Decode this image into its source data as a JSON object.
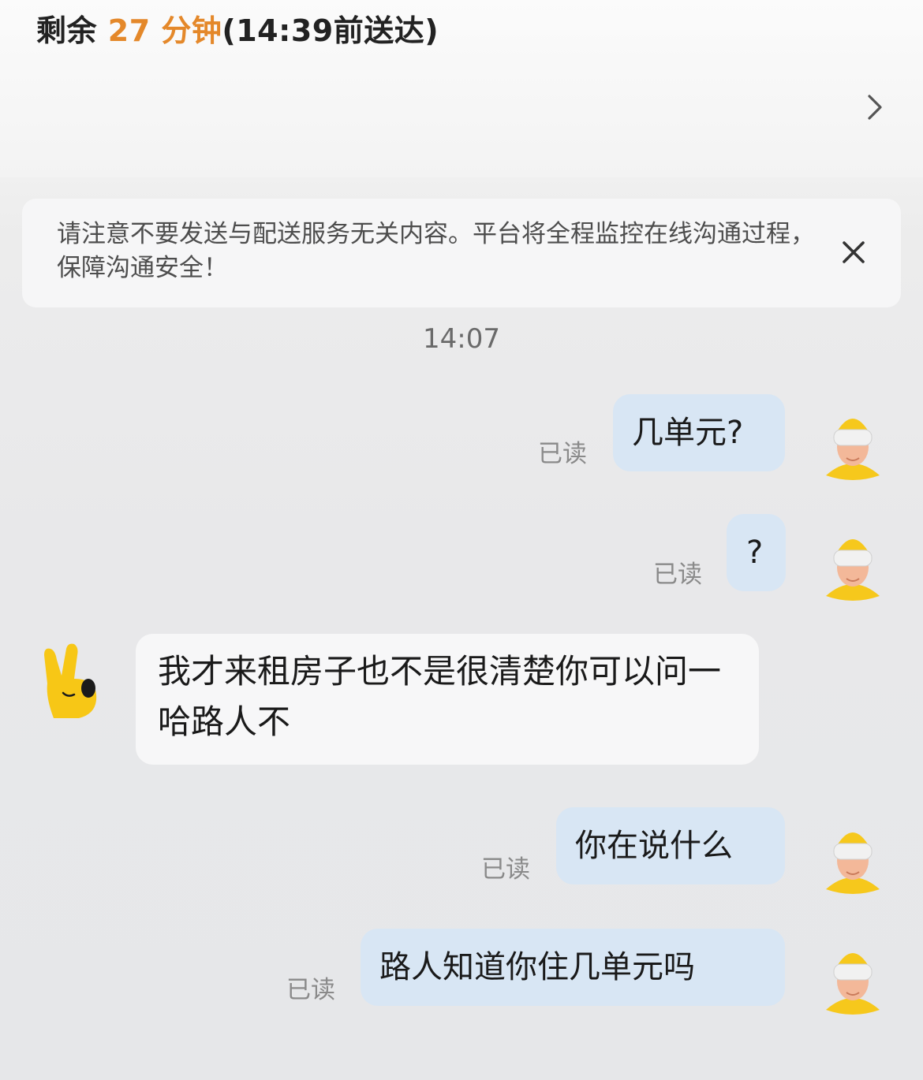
{
  "header": {
    "eta_prefix": "剩余",
    "eta_minutes": "27 分钟",
    "eta_deadline": "(14:39前送达)"
  },
  "notice": {
    "text": "请注意不要发送与配送服务无关内容。平台将全程监控在线沟通过程，保障沟通安全！"
  },
  "chat": {
    "timestamp": "14:07",
    "read_label": "已读",
    "messages": [
      {
        "side": "me",
        "text": "几单元?"
      },
      {
        "side": "me",
        "text": "?"
      },
      {
        "side": "them",
        "text": "我才来租房子也不是很清楚你可以问一哈路人不"
      },
      {
        "side": "me",
        "text": "你在说什么"
      },
      {
        "side": "me",
        "text": "路人知道你住几单元吗"
      }
    ]
  },
  "colors": {
    "accent_orange": "#e4882a",
    "my_bubble": "#d8e6f4",
    "their_bubble": "#f7f7f8",
    "rider_helmet": "#f6c81c"
  },
  "icons": {
    "nav": "chevron-right-icon",
    "close": "close-icon",
    "my_avatar": "rider-avatar-icon",
    "their_avatar": "mascot-hand-icon"
  }
}
